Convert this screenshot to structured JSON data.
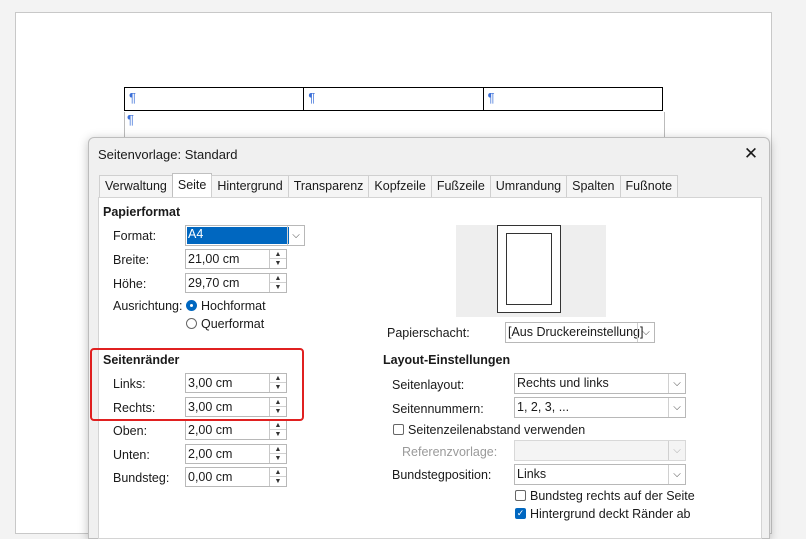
{
  "document": {
    "pilcrow": "¶",
    "table_cells": [
      "¶",
      "¶",
      "¶"
    ]
  },
  "dialog": {
    "title": "Seitenvorlage: Standard",
    "close_glyph": "✕",
    "tabs": [
      "Verwaltung",
      "Seite",
      "Hintergrund",
      "Transparenz",
      "Kopfzeile",
      "Fußzeile",
      "Umrandung",
      "Spalten",
      "Fußnote"
    ],
    "active_tab": "Seite"
  },
  "paper": {
    "section": "Papierformat",
    "format_label": "Format:",
    "format_value": "A4",
    "width_label": "Breite:",
    "width_value": "21,00 cm",
    "height_label": "Höhe:",
    "height_value": "29,70 cm",
    "orientation_label": "Ausrichtung:",
    "portrait": "Hochformat",
    "landscape": "Querformat",
    "orientation_selected": "Hochformat",
    "tray_label": "Papierschacht:",
    "tray_value": "[Aus Druckereinstellung]"
  },
  "margins": {
    "section": "Seitenränder",
    "left_label": "Links:",
    "left_value": "3,00 cm",
    "right_label": "Rechts:",
    "right_value": "3,00 cm",
    "top_label": "Oben:",
    "top_value": "2,00 cm",
    "bottom_label": "Unten:",
    "bottom_value": "2,00 cm",
    "gutter_label": "Bundsteg:",
    "gutter_value": "0,00 cm"
  },
  "layout": {
    "section": "Layout-Einstellungen",
    "page_layout_label": "Seitenlayout:",
    "page_layout_value": "Rechts und links",
    "page_numbers_label": "Seitennummern:",
    "page_numbers_value": "1, 2, 3, ...",
    "register_true_label": "Seitenzeilenabstand verwenden",
    "register_true_checked": false,
    "reference_style_label": "Referenzvorlage:",
    "reference_style_value": "",
    "gutter_position_label": "Bundstegposition:",
    "gutter_position_value": "Links",
    "gutter_right_label": "Bundsteg rechts auf der Seite",
    "gutter_right_checked": false,
    "bg_covers_label": "Hintergrund deckt Ränder ab",
    "bg_covers_checked": true
  },
  "colors": {
    "accent": "#0067c0",
    "highlight_box": "#e02020",
    "pilcrow": "#3b6fd8"
  }
}
